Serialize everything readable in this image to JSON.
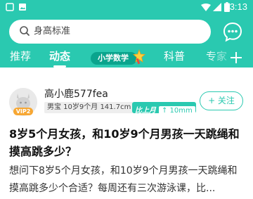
{
  "status_bar": {
    "time": "3:13",
    "icons": [
      "notification-square-icon",
      "image-icon",
      "wifi-icon",
      "signal-icon",
      "battery-icon"
    ]
  },
  "search": {
    "placeholder": "身高标准",
    "icon": "search-icon"
  },
  "header_actions": {
    "chat_icon": "chat-bubble-icon"
  },
  "tabs": [
    {
      "label": "推荐",
      "active": false
    },
    {
      "label": "动态",
      "active": true
    },
    {
      "label": "小学数学",
      "active": false,
      "badge": true
    },
    {
      "label": "科普",
      "active": false
    },
    {
      "label": "专家",
      "active": false
    }
  ],
  "tab_add_icon": "plus-icon",
  "post": {
    "user": {
      "name": "高小鹿577fea",
      "vip_label": "VIP2",
      "baby_info": "男宝 10岁9个月 141.7cm",
      "growth_level": "比上月",
      "growth_detail": "↑ 10mm"
    },
    "follow_label": "+ 关注",
    "title": "8岁5个月女孩，和10岁9个月男孩一天跳绳和摸高跳多少？",
    "body": "想问下8岁5个月女孩，和10岁9个月男孩一天跳绳和摸高跳多少个合适？每周还有三次游泳课，比..."
  },
  "colors": {
    "brand": "#2ac9b0",
    "badge_bg": "#0aa48d",
    "vip": "#f7a733"
  }
}
